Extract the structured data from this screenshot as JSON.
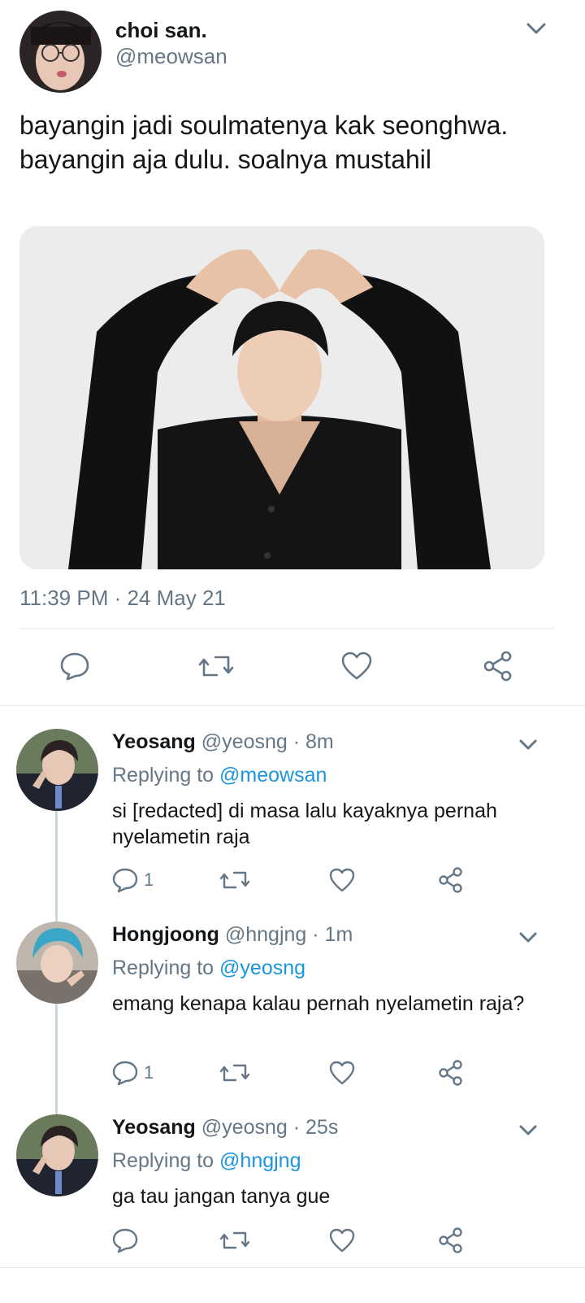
{
  "main_tweet": {
    "display_name": "choi san.",
    "handle": "@meowsan",
    "text": "bayangin jadi soulmatenya kak seonghwa. bayangin aja dulu. soalnya mustahil",
    "timestamp": "11:39 PM · 24 May 21",
    "actions": [
      "reply-icon",
      "retweet-icon",
      "like-icon",
      "share-icon"
    ]
  },
  "replies": [
    {
      "display_name": "Yeosang",
      "handle": "@yeosng",
      "time": "· 8m",
      "replying_label": "Replying to",
      "replying_to": "@meowsan",
      "text": "si [redacted] di masa lalu kayaknya pernah nyelametin raja",
      "reply_count": "1"
    },
    {
      "display_name": "Hongjoong",
      "handle": "@hngjng",
      "time": "· 1m",
      "replying_label": "Replying to",
      "replying_to": "@yeosng",
      "text": "emang kenapa kalau pernah nyelametin raja?",
      "reply_count": "1"
    },
    {
      "display_name": "Yeosang",
      "handle": "@yeosng",
      "time": "· 25s",
      "replying_label": "Replying to",
      "replying_to": "@hngjng",
      "text": "ga tau jangan tanya gue",
      "reply_count": ""
    }
  ],
  "colors": {
    "text_primary": "#14171a",
    "text_secondary": "#657786",
    "link": "#1b95e0",
    "divider": "#e1e8ed"
  }
}
